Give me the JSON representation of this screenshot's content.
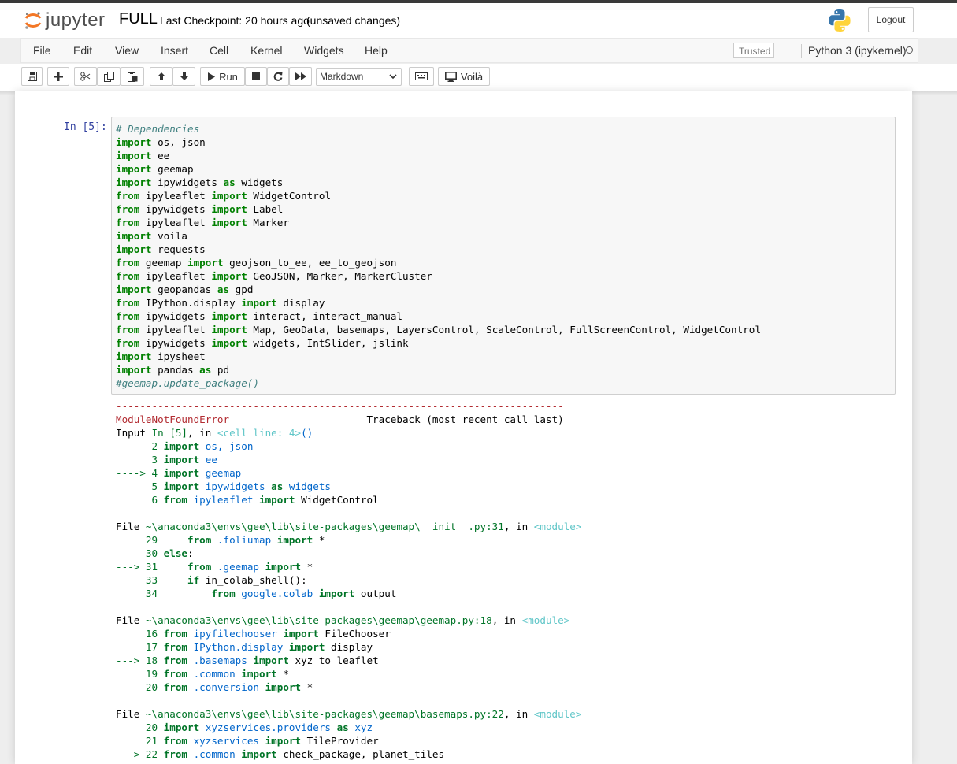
{
  "header": {
    "logo_text": "jupyter",
    "notebook_name": "FULL",
    "checkpoint": "Last Checkpoint: 20 hours ago",
    "unsaved": "(unsaved changes)",
    "logout_label": "Logout"
  },
  "menubar": {
    "items": [
      "File",
      "Edit",
      "View",
      "Insert",
      "Cell",
      "Kernel",
      "Widgets",
      "Help"
    ],
    "trusted": "Trusted",
    "kernel": "Python 3 (ipykernel)"
  },
  "toolbar": {
    "run_label": "Run",
    "cell_type": "Markdown",
    "voila_label": "Voilà"
  },
  "cell": {
    "prompt": "In [5]:",
    "code_lines": [
      [
        [
          "cm",
          "# Dependencies"
        ]
      ],
      [
        [
          "kw",
          "import"
        ],
        [
          "",
          " os, json"
        ]
      ],
      [
        [
          "kw",
          "import"
        ],
        [
          "",
          " ee"
        ]
      ],
      [
        [
          "kw",
          "import"
        ],
        [
          "",
          " geemap"
        ]
      ],
      [
        [
          "kw",
          "import"
        ],
        [
          "",
          " ipywidgets "
        ],
        [
          "kw",
          "as"
        ],
        [
          "",
          " widgets"
        ]
      ],
      [
        [
          "kw",
          "from"
        ],
        [
          "",
          " ipyleaflet "
        ],
        [
          "kw",
          "import"
        ],
        [
          "",
          " WidgetControl"
        ]
      ],
      [
        [
          "kw",
          "from"
        ],
        [
          "",
          " ipywidgets "
        ],
        [
          "kw",
          "import"
        ],
        [
          "",
          " Label"
        ]
      ],
      [
        [
          "kw",
          "from"
        ],
        [
          "",
          " ipyleaflet "
        ],
        [
          "kw",
          "import"
        ],
        [
          "",
          " Marker"
        ]
      ],
      [
        [
          "kw",
          "import"
        ],
        [
          "",
          " voila"
        ]
      ],
      [
        [
          "kw",
          "import"
        ],
        [
          "",
          " requests"
        ]
      ],
      [
        [
          "kw",
          "from"
        ],
        [
          "",
          " geemap "
        ],
        [
          "kw",
          "import"
        ],
        [
          "",
          " geojson_to_ee, ee_to_geojson"
        ]
      ],
      [
        [
          "kw",
          "from"
        ],
        [
          "",
          " ipyleaflet "
        ],
        [
          "kw",
          "import"
        ],
        [
          "",
          " GeoJSON, Marker, MarkerCluster"
        ]
      ],
      [
        [
          "kw",
          "import"
        ],
        [
          "",
          " geopandas "
        ],
        [
          "kw",
          "as"
        ],
        [
          "",
          " gpd"
        ]
      ],
      [
        [
          "kw",
          "from"
        ],
        [
          "",
          " IPython.display "
        ],
        [
          "kw",
          "import"
        ],
        [
          "",
          " display"
        ]
      ],
      [
        [
          "kw",
          "from"
        ],
        [
          "",
          " ipywidgets "
        ],
        [
          "kw",
          "import"
        ],
        [
          "",
          " interact, interact_manual"
        ]
      ],
      [
        [
          "kw",
          "from"
        ],
        [
          "",
          " ipyleaflet "
        ],
        [
          "kw",
          "import"
        ],
        [
          "",
          " Map, GeoData, basemaps, LayersControl, ScaleControl, FullScreenControl, WidgetControl"
        ]
      ],
      [
        [
          "kw",
          "from"
        ],
        [
          "",
          " ipywidgets "
        ],
        [
          "kw",
          "import"
        ],
        [
          "",
          " widgets, IntSlider, jslink"
        ]
      ],
      [
        [
          "kw",
          "import"
        ],
        [
          "",
          " ipysheet"
        ]
      ],
      [
        [
          "kw",
          "import"
        ],
        [
          "",
          " pandas "
        ],
        [
          "kw",
          "as"
        ],
        [
          "",
          " pd"
        ]
      ],
      [
        [
          "cm",
          "#geemap.update_package()"
        ]
      ]
    ],
    "output_lines": [
      [
        [
          "red",
          "---------------------------------------------------------------------------"
        ]
      ],
      [
        [
          "red",
          "ModuleNotFoundError"
        ],
        [
          "",
          "                       Traceback (most recent call last)"
        ]
      ],
      [
        [
          "",
          "Input "
        ],
        [
          "grn",
          "In [5]"
        ],
        [
          "",
          ", in "
        ],
        [
          "cyan",
          "<cell line: 4>"
        ],
        [
          "blu",
          "()"
        ]
      ],
      [
        [
          "grn",
          "      2"
        ],
        [
          "",
          " "
        ],
        [
          "grnb",
          "import"
        ],
        [
          "blu",
          " os, json"
        ]
      ],
      [
        [
          "grn",
          "      3"
        ],
        [
          "",
          " "
        ],
        [
          "grnb",
          "import"
        ],
        [
          "blu",
          " ee"
        ]
      ],
      [
        [
          "grn",
          "----> 4"
        ],
        [
          "",
          " "
        ],
        [
          "grnb",
          "import"
        ],
        [
          "blu",
          " geemap"
        ]
      ],
      [
        [
          "grn",
          "      5"
        ],
        [
          "",
          " "
        ],
        [
          "grnb",
          "import"
        ],
        [
          "blu",
          " ipywidgets "
        ],
        [
          "grnb",
          "as"
        ],
        [
          "blu",
          " widgets"
        ]
      ],
      [
        [
          "grn",
          "      6"
        ],
        [
          "",
          " "
        ],
        [
          "grnb",
          "from"
        ],
        [
          "blu",
          " ipyleaflet "
        ],
        [
          "grnb",
          "import"
        ],
        [
          "",
          " WidgetControl"
        ]
      ],
      [
        [
          "",
          ""
        ]
      ],
      [
        [
          "",
          "File "
        ],
        [
          "grn",
          "~\\anaconda3\\envs\\gee\\lib\\site-packages\\geemap\\__init__.py:31"
        ],
        [
          "",
          ", in "
        ],
        [
          "cyan",
          "<module>"
        ]
      ],
      [
        [
          "grn",
          "     29"
        ],
        [
          "",
          "     "
        ],
        [
          "grnb",
          "from"
        ],
        [
          "blu",
          " .foliumap "
        ],
        [
          "grnb",
          "import"
        ],
        [
          "",
          " *"
        ]
      ],
      [
        [
          "grn",
          "     30"
        ],
        [
          "",
          " "
        ],
        [
          "grnb",
          "else"
        ],
        [
          "",
          ":"
        ]
      ],
      [
        [
          "grn",
          "---> 31"
        ],
        [
          "",
          "     "
        ],
        [
          "grnb",
          "from"
        ],
        [
          "blu",
          " .geemap "
        ],
        [
          "grnb",
          "import"
        ],
        [
          "",
          " *"
        ]
      ],
      [
        [
          "grn",
          "     33"
        ],
        [
          "",
          "     "
        ],
        [
          "grnb",
          "if"
        ],
        [
          "",
          " in_colab_shell():"
        ]
      ],
      [
        [
          "grn",
          "     34"
        ],
        [
          "",
          "         "
        ],
        [
          "grnb",
          "from"
        ],
        [
          "blu",
          " google.colab "
        ],
        [
          "grnb",
          "import"
        ],
        [
          "",
          " output"
        ]
      ],
      [
        [
          "",
          ""
        ]
      ],
      [
        [
          "",
          "File "
        ],
        [
          "grn",
          "~\\anaconda3\\envs\\gee\\lib\\site-packages\\geemap\\geemap.py:18"
        ],
        [
          "",
          ", in "
        ],
        [
          "cyan",
          "<module>"
        ]
      ],
      [
        [
          "grn",
          "     16"
        ],
        [
          "",
          " "
        ],
        [
          "grnb",
          "from"
        ],
        [
          "blu",
          " ipyfilechooser "
        ],
        [
          "grnb",
          "import"
        ],
        [
          "",
          " FileChooser"
        ]
      ],
      [
        [
          "grn",
          "     17"
        ],
        [
          "",
          " "
        ],
        [
          "grnb",
          "from"
        ],
        [
          "blu",
          " IPython.display "
        ],
        [
          "grnb",
          "import"
        ],
        [
          "",
          " display"
        ]
      ],
      [
        [
          "grn",
          "---> 18"
        ],
        [
          "",
          " "
        ],
        [
          "grnb",
          "from"
        ],
        [
          "blu",
          " .basemaps "
        ],
        [
          "grnb",
          "import"
        ],
        [
          "",
          " xyz_to_leaflet"
        ]
      ],
      [
        [
          "grn",
          "     19"
        ],
        [
          "",
          " "
        ],
        [
          "grnb",
          "from"
        ],
        [
          "blu",
          " .common "
        ],
        [
          "grnb",
          "import"
        ],
        [
          "",
          " *"
        ]
      ],
      [
        [
          "grn",
          "     20"
        ],
        [
          "",
          " "
        ],
        [
          "grnb",
          "from"
        ],
        [
          "blu",
          " .conversion "
        ],
        [
          "grnb",
          "import"
        ],
        [
          "",
          " *"
        ]
      ],
      [
        [
          "",
          ""
        ]
      ],
      [
        [
          "",
          "File "
        ],
        [
          "grn",
          "~\\anaconda3\\envs\\gee\\lib\\site-packages\\geemap\\basemaps.py:22"
        ],
        [
          "",
          ", in "
        ],
        [
          "cyan",
          "<module>"
        ]
      ],
      [
        [
          "grn",
          "     20"
        ],
        [
          "",
          " "
        ],
        [
          "grnb",
          "import"
        ],
        [
          "blu",
          " xyzservices.providers "
        ],
        [
          "grnb",
          "as"
        ],
        [
          "blu",
          " xyz"
        ]
      ],
      [
        [
          "grn",
          "     21"
        ],
        [
          "",
          " "
        ],
        [
          "grnb",
          "from"
        ],
        [
          "blu",
          " xyzservices "
        ],
        [
          "grnb",
          "import"
        ],
        [
          "",
          " TileProvider"
        ]
      ],
      [
        [
          "grn",
          "---> 22"
        ],
        [
          "",
          " "
        ],
        [
          "grnb",
          "from"
        ],
        [
          "blu",
          " .common "
        ],
        [
          "grnb",
          "import"
        ],
        [
          "",
          " check_package, planet_tiles"
        ]
      ]
    ]
  },
  "colors": {
    "jupyter_orange": "#f37726",
    "prompt_blue": "#303f9f",
    "error_red": "#b22b31"
  },
  "icons": [
    "save-icon",
    "plus-icon",
    "cut-icon",
    "copy-icon",
    "paste-icon",
    "arrow-up-icon",
    "arrow-down-icon",
    "play-icon",
    "stop-icon",
    "restart-icon",
    "fast-forward-icon",
    "keyboard-icon",
    "desktop-icon",
    "python-logo-icon",
    "kernel-idle-icon"
  ]
}
